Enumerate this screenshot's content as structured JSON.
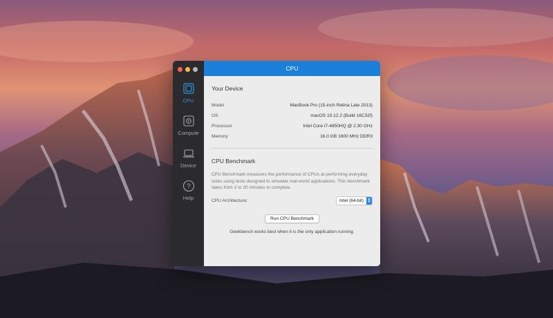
{
  "window": {
    "title": "CPU"
  },
  "sidebar": {
    "items": [
      {
        "label": "CPU",
        "icon": "cpu-icon",
        "active": true
      },
      {
        "label": "Compute",
        "icon": "compute-icon",
        "active": false
      },
      {
        "label": "Device",
        "icon": "laptop-icon",
        "active": false
      },
      {
        "label": "Help",
        "icon": "help-icon",
        "active": false
      }
    ]
  },
  "device": {
    "heading": "Your Device",
    "rows": [
      {
        "key": "Model",
        "value": "MacBook Pro (15-inch Retina Late 2013)"
      },
      {
        "key": "OS",
        "value": "macOS 10.12.2 (Build 16C32f)"
      },
      {
        "key": "Processor",
        "value": "Intel Core i7-4850HQ @ 2.30 GHz"
      },
      {
        "key": "Memory",
        "value": "16.0 GB 1600 MHz DDR3"
      }
    ]
  },
  "benchmark": {
    "heading": "CPU Benchmark",
    "description": "CPU Benchmark measures the performance of CPUs at performing everyday tasks using tests designed to simulate real-world applications. This benchmark takes from 2 to 20 minutes to complete.",
    "arch_label": "CPU Architecture:",
    "arch_value": "Intel (64-bit)",
    "run_button": "Run CPU Benchmark",
    "note": "Geekbench works best when it is the only application running."
  },
  "colors": {
    "accent": "#1a80d9",
    "sidebar": "#2b2b2d",
    "panel": "#ececec"
  }
}
